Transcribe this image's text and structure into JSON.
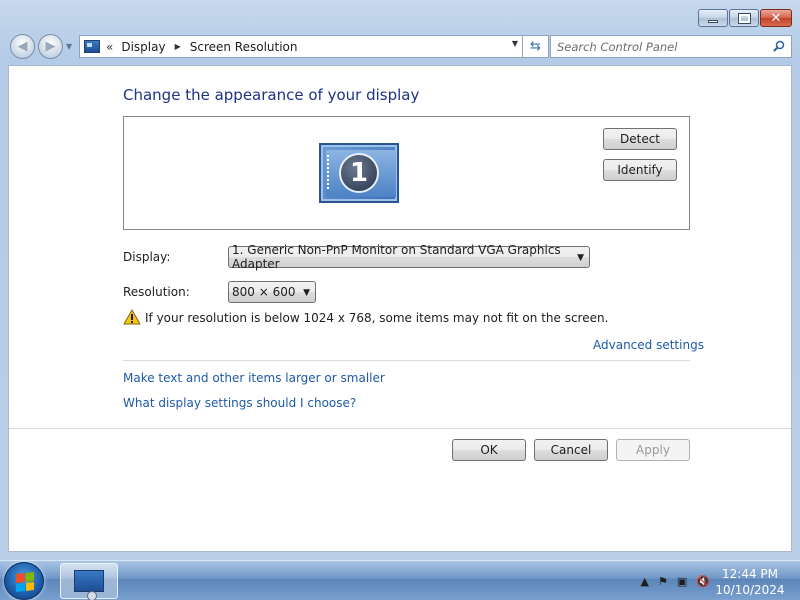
{
  "window": {
    "caption_buttons": [
      "minimize",
      "maximize",
      "close"
    ]
  },
  "nav": {
    "back_icon": "back-arrow-icon",
    "forward_icon": "forward-arrow-icon",
    "address_chevron": "«",
    "breadcrumb": [
      "Display",
      "Screen Resolution"
    ],
    "search_placeholder": "Search Control Panel"
  },
  "main": {
    "title": "Change the appearance of your display",
    "monitor_number": "1",
    "detect_label": "Detect",
    "identify_label": "Identify",
    "display_label": "Display:",
    "display_value": "1. Generic Non-PnP Monitor on Standard VGA Graphics Adapter",
    "resolution_label": "Resolution:",
    "resolution_value": "800 × 600",
    "warning_text": "If your resolution is below 1024 x 768, some items may not fit on the screen.",
    "advanced_settings": "Advanced settings",
    "link_text_size": "Make text and other items larger or smaller",
    "link_help": "What display settings should I choose?"
  },
  "footer": {
    "ok_label": "OK",
    "cancel_label": "Cancel",
    "apply_label": "Apply",
    "apply_enabled": false
  },
  "taskbar": {
    "time": "12:44 PM",
    "date": "10/10/2024"
  },
  "colors": {
    "title_blue": "#1e3287",
    "link_blue": "#1e5aa8"
  }
}
